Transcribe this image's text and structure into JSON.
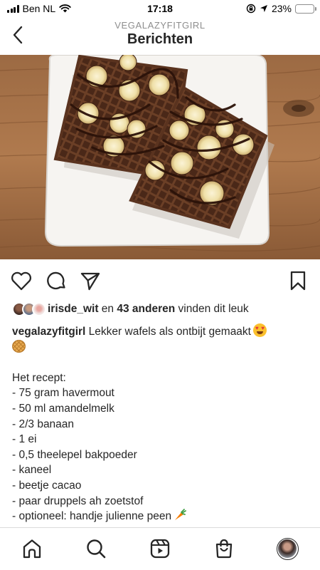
{
  "status_bar": {
    "carrier": "Ben NL",
    "time": "17:18",
    "battery": "23%",
    "battery_level": 0.23,
    "icons": [
      "signal-icon",
      "wifi-icon",
      "orientation-lock-icon",
      "location-icon",
      "battery-icon"
    ]
  },
  "header": {
    "username": "VEGALAZYFITGIRL",
    "title": "Berichten",
    "back_icon": "chevron-left-icon"
  },
  "post": {
    "image_icon": "photo",
    "actions": [
      "heart-icon",
      "comment-icon",
      "share-icon",
      "bookmark-icon"
    ],
    "likes": {
      "first_user": "irisde_wit",
      "connector": " en ",
      "others": "43 anderen",
      "suffix": " vinden dit leuk"
    },
    "caption": {
      "username": "vegalazyfitgirl",
      "text": " Lekker wafels als ontbijt gemaakt",
      "recipe_heading": "Het recept:",
      "ingredients": [
        "- 75 gram havermout",
        "- 50 ml amandelmelk",
        "- 2/3 banaan",
        "- 1 ei",
        "- 0,5 theelepel bakpoeder",
        "- kaneel",
        "- beetje cacao",
        "- paar druppels ah zoetstof",
        "- optioneel: handje julienne peen"
      ]
    }
  },
  "bottom_nav": [
    "home-icon",
    "search-icon",
    "reels-icon",
    "shop-icon",
    "profile-avatar"
  ],
  "colors": {
    "text": "#262626",
    "secondary": "#8e8e8e",
    "battery": "#f5c82a",
    "divider": "#dbdbdb"
  }
}
